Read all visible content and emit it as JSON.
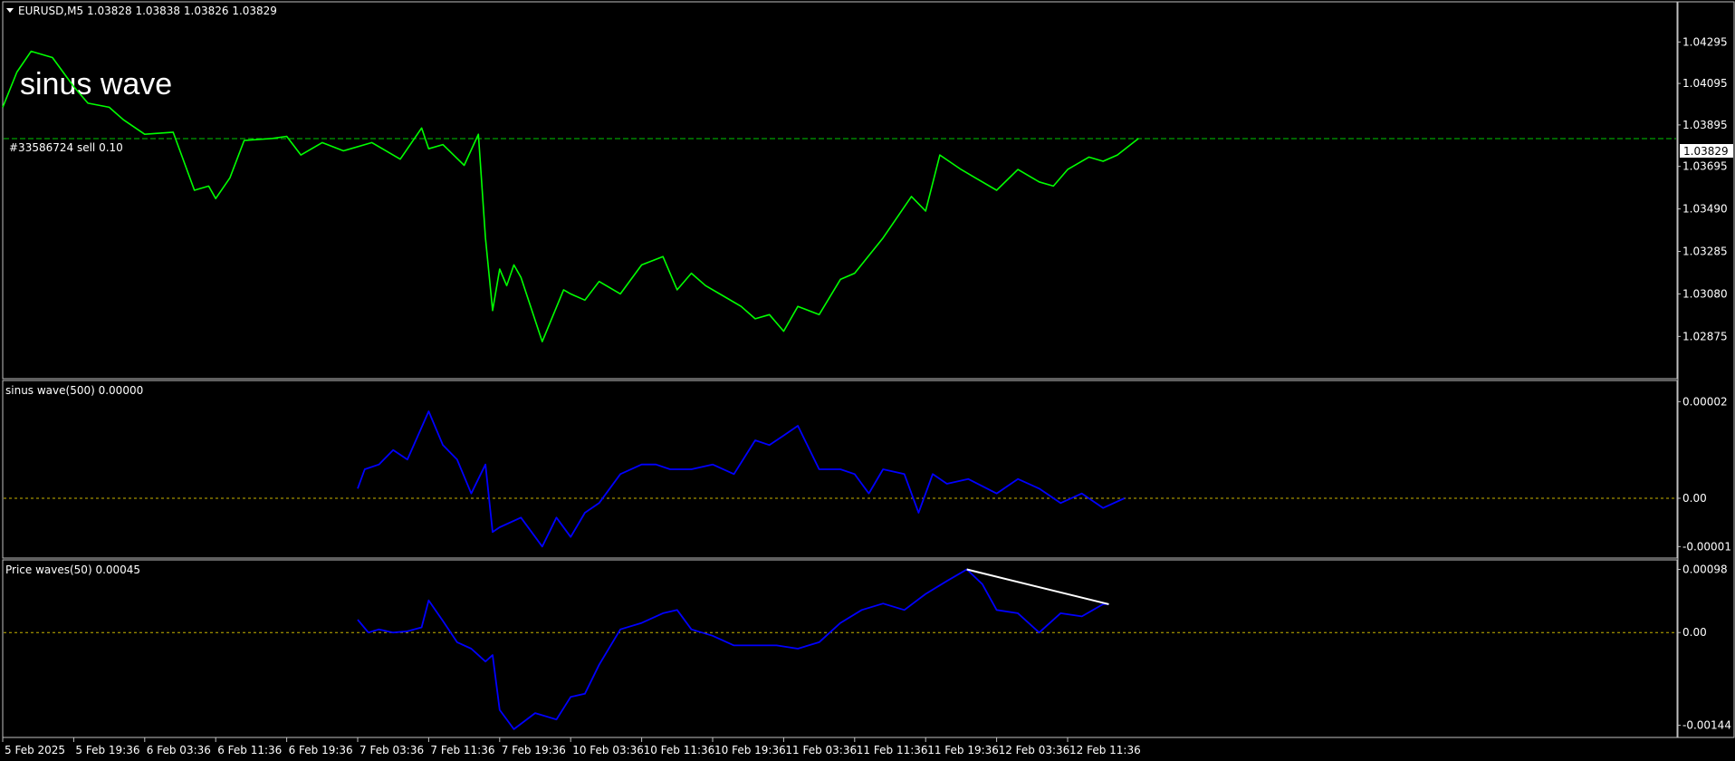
{
  "header": {
    "symbol": "EURUSD,M5",
    "ohlc": "1.03828 1.03838 1.03826 1.03829"
  },
  "overlay_label": "sinus wave",
  "order_label": "#33586724 sell 0.10",
  "price_tag": "1.03829",
  "colors": {
    "price_line": "#00ff00",
    "indicator_line": "#0000ff",
    "level_line": "#c8b400",
    "order_line": "#00c800",
    "trend_line": "#ffffff",
    "frame": "#c0c0c0"
  },
  "chart_data": [
    {
      "type": "line",
      "title": "EURUSD,M5",
      "ylim": [
        1.0268,
        1.0448
      ],
      "y_ticks": [
        "1.04295",
        "1.04095",
        "1.03895",
        "1.03695",
        "1.03490",
        "1.03285",
        "1.03080",
        "1.02875"
      ],
      "y_tick_values": [
        1.04295,
        1.04095,
        1.03895,
        1.03695,
        1.0349,
        1.03285,
        1.0308,
        1.02875
      ],
      "order_level": 1.03829,
      "series": [
        {
          "x": [
            0,
            0.2,
            0.4,
            0.7,
            1,
            1.2,
            1.5,
            1.7,
            2.0,
            2.4,
            2.7,
            2.9,
            3.0,
            3.2,
            3.4,
            3.8,
            4.0,
            4.2,
            4.5,
            4.8,
            5.2,
            5.6,
            5.9,
            6.0,
            6.2,
            6.5,
            6.7,
            6.8,
            6.9,
            7.0,
            7.1,
            7.2,
            7.3,
            7.6,
            7.9,
            8.0,
            8.2,
            8.4,
            8.7,
            9.0,
            9.3,
            9.5,
            9.7,
            9.9,
            10.2,
            10.4,
            10.6,
            10.8,
            11.0,
            11.2,
            11.5,
            11.8,
            12.0,
            12.4,
            12.8,
            13.0,
            13.2,
            13.5,
            13.7,
            14.0,
            14.3,
            14.6,
            14.8,
            15.0,
            15.3,
            15.5,
            15.7,
            16.0
          ],
          "values": [
            1.0398,
            1.0415,
            1.0425,
            1.0422,
            1.0408,
            1.04,
            1.0398,
            1.0392,
            1.0385,
            1.0386,
            1.0358,
            1.036,
            1.0354,
            1.0364,
            1.0382,
            1.0383,
            1.0384,
            1.0375,
            1.0381,
            1.0377,
            1.0381,
            1.0373,
            1.0388,
            1.0378,
            1.038,
            1.037,
            1.0385,
            1.0335,
            1.03,
            1.032,
            1.0312,
            1.0322,
            1.0316,
            1.0285,
            1.031,
            1.0308,
            1.0305,
            1.0314,
            1.0308,
            1.0322,
            1.0326,
            1.031,
            1.0318,
            1.0312,
            1.0306,
            1.0302,
            1.0296,
            1.0298,
            1.029,
            1.0302,
            1.0298,
            1.0315,
            1.0318,
            1.0335,
            1.0355,
            1.0348,
            1.0375,
            1.0368,
            1.0364,
            1.0358,
            1.0368,
            1.0362,
            1.036,
            1.0368,
            1.0374,
            1.0372,
            1.0375,
            1.0383
          ]
        }
      ]
    },
    {
      "type": "line",
      "title": "sinus wave(500) 0.00000",
      "ylim": [
        -1.2e-05,
        2.4e-05
      ],
      "y_ticks": [
        "0.00002",
        "0.00",
        "-0.00001"
      ],
      "y_tick_values": [
        2e-05,
        0,
        -1e-05
      ],
      "level": 0,
      "series": [
        {
          "x": [
            5.0,
            5.1,
            5.3,
            5.5,
            5.7,
            6.0,
            6.2,
            6.4,
            6.6,
            6.8,
            6.9,
            7.0,
            7.3,
            7.6,
            7.8,
            8.0,
            8.2,
            8.4,
            8.7,
            9.0,
            9.2,
            9.4,
            9.7,
            10.0,
            10.3,
            10.6,
            10.8,
            11.0,
            11.2,
            11.5,
            11.8,
            12.0,
            12.1,
            12.2,
            12.4,
            12.7,
            12.9,
            13.0,
            13.1,
            13.3,
            13.6,
            14.0,
            14.3,
            14.6,
            14.9,
            15.2,
            15.5,
            15.8
          ],
          "values": [
            2e-06,
            6e-06,
            7e-06,
            1e-05,
            8e-06,
            1.8e-05,
            1.1e-05,
            8e-06,
            1e-06,
            7e-06,
            -7e-06,
            -6e-06,
            -4e-06,
            -1e-05,
            -4e-06,
            -8e-06,
            -3e-06,
            -1e-06,
            5e-06,
            7e-06,
            7e-06,
            6e-06,
            6e-06,
            7e-06,
            5e-06,
            1.2e-05,
            1.1e-05,
            1.3e-05,
            1.5e-05,
            6e-06,
            6e-06,
            5e-06,
            3e-06,
            1e-06,
            6e-06,
            5e-06,
            -3e-06,
            1e-06,
            5e-06,
            3e-06,
            4e-06,
            1e-06,
            4e-06,
            2e-06,
            -1e-06,
            1e-06,
            -2e-06,
            0.0
          ]
        }
      ]
    },
    {
      "type": "line",
      "title": "Price waves(50) 0.00045",
      "ylim": [
        -0.00016,
        0.00011
      ],
      "y_ticks": [
        "0.00098",
        "0.00",
        "-0.00144"
      ],
      "y_tick_values": [
        9.8e-05,
        0,
        -0.000144
      ],
      "level": 0,
      "trend_line": {
        "x": [
          13.58,
          15.58
        ],
        "values": [
          9.8e-05,
          4.4e-05
        ]
      },
      "series": [
        {
          "x": [
            5.0,
            5.15,
            5.3,
            5.5,
            5.7,
            5.9,
            6.0,
            6.2,
            6.4,
            6.6,
            6.8,
            6.9,
            7.0,
            7.2,
            7.5,
            7.8,
            8.0,
            8.2,
            8.4,
            8.7,
            9.0,
            9.3,
            9.5,
            9.7,
            10.0,
            10.3,
            10.6,
            10.9,
            11.2,
            11.5,
            11.8,
            12.1,
            12.4,
            12.7,
            13.0,
            13.3,
            13.58,
            13.8,
            14.0,
            14.3,
            14.6,
            14.9,
            15.2,
            15.5,
            15.58
          ],
          "values": [
            2e-05,
            0.0,
            5e-06,
            0.0,
            2e-06,
            8e-06,
            5e-05,
            1.8e-05,
            -1.5e-05,
            -2.5e-05,
            -4.5e-05,
            -3.5e-05,
            -0.00012,
            -0.00015,
            -0.000125,
            -0.000135,
            -0.0001,
            -9.5e-05,
            -5e-05,
            5e-06,
            1.5e-05,
            3e-05,
            3.5e-05,
            5e-06,
            -5e-06,
            -2e-05,
            -2e-05,
            -2e-05,
            -2.5e-05,
            -1.5e-05,
            1.5e-05,
            3.5e-05,
            4.5e-05,
            3.5e-05,
            6e-05,
            8e-05,
            9.8e-05,
            7.5e-05,
            3.5e-05,
            3e-05,
            0.0,
            3e-05,
            2.5e-05,
            4.4e-05,
            4.4e-05
          ]
        }
      ]
    }
  ],
  "x_axis": {
    "labels": [
      "5 Feb 2025",
      "5 Feb 19:36",
      "6 Feb 03:36",
      "6 Feb 11:36",
      "6 Feb 19:36",
      "7 Feb 03:36",
      "7 Feb 11:36",
      "7 Feb 19:36",
      "10 Feb 03:36",
      "10 Feb 11:36",
      "10 Feb 19:36",
      "11 Feb 03:36",
      "11 Feb 11:36",
      "11 Feb 19:36",
      "12 Feb 03:36",
      "12 Feb 11:36"
    ]
  }
}
